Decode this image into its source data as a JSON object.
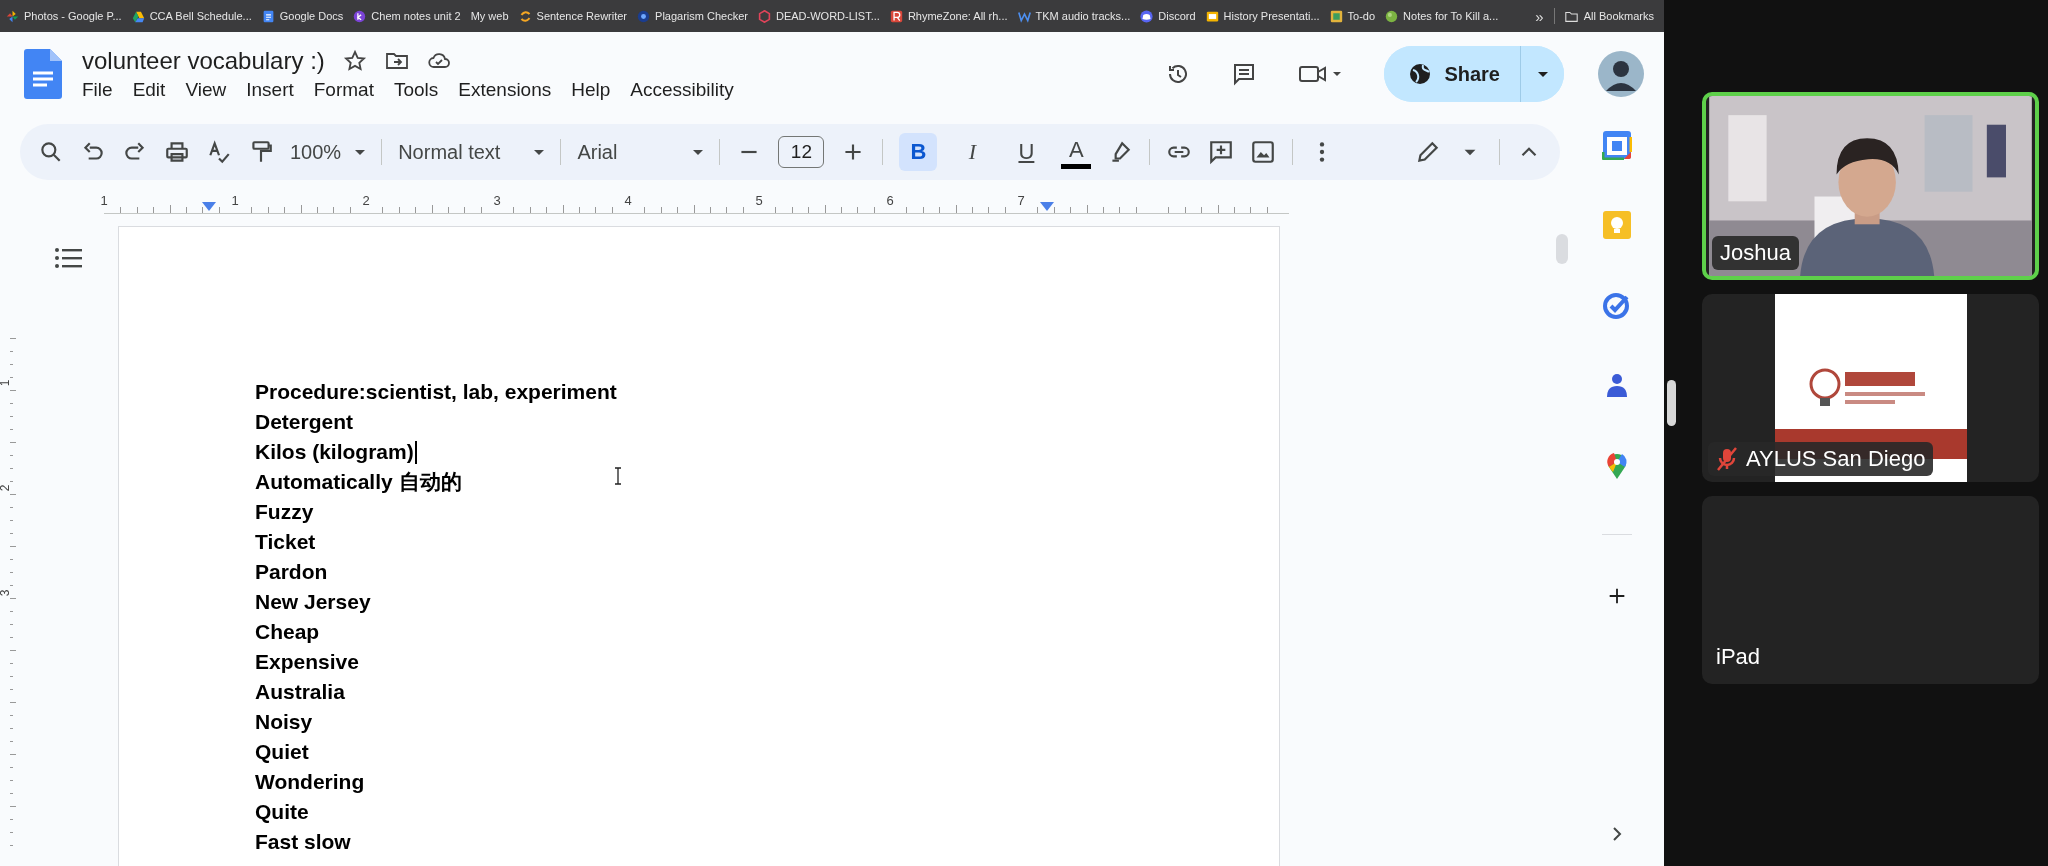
{
  "bookmarks": [
    {
      "label": "Photos - Google P...",
      "kind": "pinwheel"
    },
    {
      "label": "CCA Bell Schedule...",
      "kind": "drive"
    },
    {
      "label": "Google Docs",
      "kind": "docs"
    },
    {
      "label": "Chem notes unit 2",
      "kind": "k"
    },
    {
      "label": "My web",
      "kind": "none"
    },
    {
      "label": "Sentence Rewriter",
      "kind": "swirl"
    },
    {
      "label": "Plagarism Checker",
      "kind": "dot"
    },
    {
      "label": "DEAD-WORD-LIST...",
      "kind": "hex"
    },
    {
      "label": "RhymeZone: All rh...",
      "kind": "r"
    },
    {
      "label": "TKM audio tracks...",
      "kind": "w"
    },
    {
      "label": "Discord",
      "kind": "discord"
    },
    {
      "label": "History Presentati...",
      "kind": "slides"
    },
    {
      "label": "To-do",
      "kind": "todo"
    },
    {
      "label": "Notes for To Kill a...",
      "kind": "ball"
    }
  ],
  "bookmarks_overflow": "»",
  "all_bookmarks": "All Bookmarks",
  "document": {
    "title": "volunteer vocabulary :)",
    "menu": [
      "File",
      "Edit",
      "View",
      "Insert",
      "Format",
      "Tools",
      "Extensions",
      "Help",
      "Accessibility"
    ],
    "share": "Share"
  },
  "toolbar": {
    "zoom": "100%",
    "style": "Normal text",
    "font": "Arial",
    "font_size": "12",
    "format_buttons": [
      {
        "kind": "bold",
        "label": "B",
        "selected": true
      },
      {
        "kind": "italic",
        "label": "I",
        "selected": false
      },
      {
        "kind": "underline",
        "label": "U",
        "selected": false
      },
      {
        "kind": "text_color",
        "label": "A",
        "selected": false
      }
    ]
  },
  "ruler": [
    "1",
    "1",
    "2",
    "3",
    "4",
    "5",
    "6",
    "7"
  ],
  "vertical_ruler": [
    "1",
    "2",
    "3"
  ],
  "lines": [
    {
      "text": "Procedure:scientist, lab, experiment",
      "cursor": false
    },
    {
      "text": "Detergent",
      "cursor": false
    },
    {
      "text": "Kilos (kilogram)",
      "cursor": true
    },
    {
      "text": "Automatically 自动的",
      "cursor": false
    },
    {
      "text": "Fuzzy",
      "cursor": false
    },
    {
      "text": "Ticket",
      "cursor": false
    },
    {
      "text": "Pardon",
      "cursor": false
    },
    {
      "text": "New Jersey",
      "cursor": false
    },
    {
      "text": "Cheap",
      "cursor": false
    },
    {
      "text": "Expensive",
      "cursor": false
    },
    {
      "text": "Australia",
      "cursor": false
    },
    {
      "text": "Noisy",
      "cursor": false
    },
    {
      "text": "Quiet",
      "cursor": false
    },
    {
      "text": "Wondering",
      "cursor": false
    },
    {
      "text": "Quite",
      "cursor": false
    },
    {
      "text": "Fast slow",
      "cursor": false
    }
  ],
  "participants": [
    {
      "name": "Joshua",
      "kind": "video",
      "speaking": true,
      "muted": false
    },
    {
      "name": "AYLUS San Diego",
      "kind": "picture",
      "speaking": false,
      "muted": true
    },
    {
      "name": "iPad",
      "kind": "blank",
      "speaking": false,
      "muted": false
    }
  ]
}
